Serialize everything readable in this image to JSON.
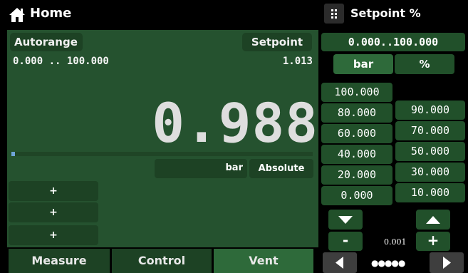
{
  "header": {
    "title": "Home",
    "icon": "home-icon"
  },
  "right_header": {
    "title": "Setpoint %",
    "icon": "grip-icon"
  },
  "main": {
    "range_mode": "Autorange",
    "setpoint_label": "Setpoint",
    "range_text": "0.000 .. 100.000",
    "setpoint_value": "1.013",
    "reading": "0.988",
    "progress_fraction": 0.012,
    "unit": "bar",
    "mode": "Absolute",
    "plus_buttons": [
      "+",
      "+",
      "+"
    ]
  },
  "tabs": [
    "Measure",
    "Control",
    "Vent"
  ],
  "setpoint_panel": {
    "range": "0.000..100.000",
    "unit_tabs": [
      "bar",
      "%"
    ],
    "presets_left": [
      "100.000",
      "80.000",
      "60.000",
      "40.000",
      "20.000",
      "0.000"
    ],
    "presets_right": [
      "90.000",
      "70.000",
      "50.000",
      "30.000",
      "10.000"
    ],
    "decrement_label": "-",
    "increment_label": "+",
    "step": "0.001",
    "page_dots": "●●●●●"
  },
  "colors": {
    "panel_green": "#25522f",
    "dark_green": "#1d4224",
    "button_green": "#21502a",
    "background": "#000000"
  }
}
